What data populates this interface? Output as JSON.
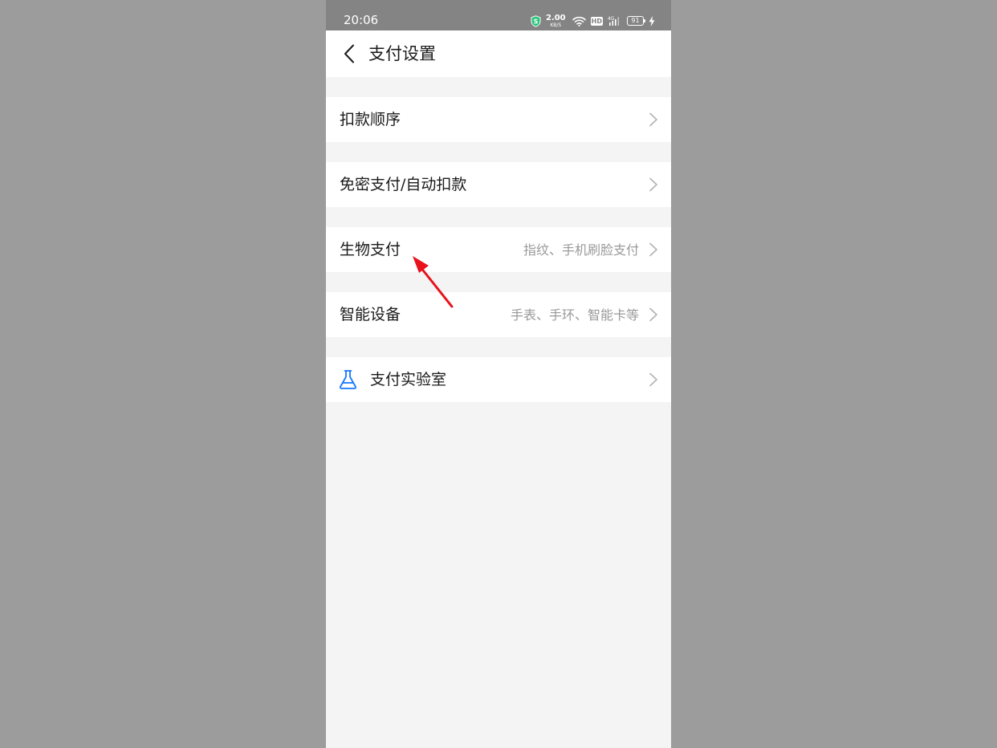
{
  "status_bar": {
    "time": "20:06",
    "net_speed_value": "2.00",
    "net_speed_unit": "KB/S",
    "hd_label": "HD",
    "network_label": "4G",
    "battery_level": "91",
    "icons": [
      "shield-s-icon",
      "wifi-icon",
      "hd-icon",
      "signal-icon",
      "battery-icon",
      "charging-icon"
    ]
  },
  "header": {
    "title": "支付设置",
    "back_icon": "chevron-left-icon"
  },
  "settings": [
    {
      "label": "扣款顺序",
      "value": ""
    },
    {
      "label": "免密支付/自动扣款",
      "value": ""
    },
    {
      "label": "生物支付",
      "value": "指纹、手机刷脸支付"
    },
    {
      "label": "智能设备",
      "value": "手表、手环、智能卡等"
    },
    {
      "label": "支付实验室",
      "value": "",
      "icon": "flask-icon"
    }
  ],
  "colors": {
    "accent_icon": "#1677ff",
    "annotation_arrow": "#e8111c",
    "status_bar_bg": "#848484",
    "page_bg": "#f4f4f4",
    "outer_bg": "#9c9c9c"
  }
}
